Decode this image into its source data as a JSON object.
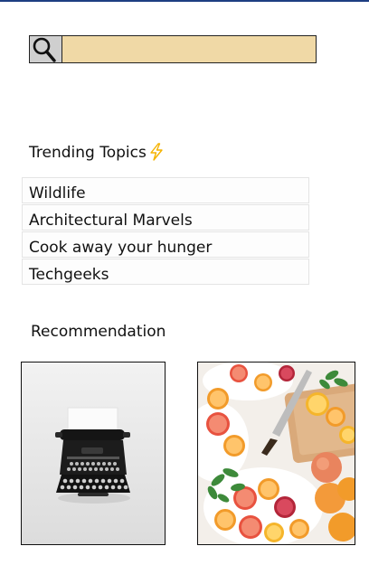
{
  "search": {
    "placeholder": "",
    "value": "",
    "icon": "search-icon",
    "colors": {
      "field": "#f0d9a6",
      "button": "#cfcfcf"
    }
  },
  "trending": {
    "title": "Trending Topics",
    "icon": "lightning-bolt-icon",
    "items": [
      {
        "label": "Wildlife"
      },
      {
        "label": "Architectural Marvels"
      },
      {
        "label": "Cook away your hunger"
      },
      {
        "label": "Techgeeks"
      }
    ]
  },
  "recommendation": {
    "title": "Recommendation",
    "cards": [
      {
        "image": "typewriter-photo"
      },
      {
        "image": "citrus-fruit-photo"
      }
    ]
  },
  "colors": {
    "top_rule": "#1e3e82",
    "bolt": "#f5b300"
  }
}
